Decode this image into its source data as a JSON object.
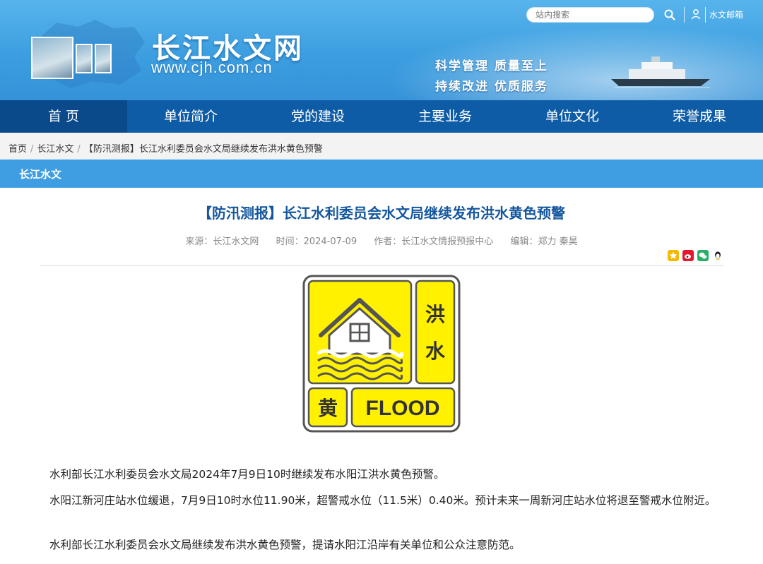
{
  "header": {
    "site_name": "长江水文网",
    "site_url": "www.cjh.com.cn",
    "slogan_line1": "科学管理  质量至上",
    "slogan_line2": "持续改进  优质服务",
    "search_placeholder": "站内搜索",
    "mail_label": "水文邮箱",
    "colors": {
      "banner": "#3c9ee0",
      "nav": "#0f5ca6",
      "accent": "#3f9de2"
    }
  },
  "nav": {
    "items": [
      {
        "label": "首 页",
        "active": true
      },
      {
        "label": "单位简介"
      },
      {
        "label": "党的建设"
      },
      {
        "label": "主要业务"
      },
      {
        "label": "单位文化"
      },
      {
        "label": "荣誉成果"
      }
    ]
  },
  "breadcrumb": {
    "items": [
      "首页",
      "长江水文",
      "【防汛测报】长江水利委员会水文局继续发布洪水黄色预警"
    ]
  },
  "section": {
    "title": "长江水文"
  },
  "article": {
    "title": "【防汛测报】长江水利委员会水文局继续发布洪水黄色预警",
    "source": "来源：长江水文网",
    "time": "时间：2024-07-09",
    "author": "作者：长江水文情报预报中心",
    "editor": "编辑：郑力 秦昊",
    "warning_icon": {
      "chars_top": "洪",
      "chars_bottom": "水",
      "level_char": "黄",
      "word": "FLOOD",
      "color": "#fff100"
    },
    "paragraphs": [
      "水利部长江水利委员会水文局2024年7月9日10时继续发布水阳江洪水黄色预警。",
      "水阳江新河庄站水位缓退，7月9日10时水位11.90米，超警戒水位（11.5米）0.40米。预计未来一周新河庄站水位将退至警戒水位附近。",
      "水利部长江水利委员会水文局继续发布洪水黄色预警，提请水阳江沿岸有关单位和公众注意防范。"
    ]
  },
  "icons": [
    "search-icon",
    "user-icon",
    "share-qzone-icon",
    "share-weibo-icon",
    "share-wechat-icon",
    "share-qq-icon"
  ]
}
